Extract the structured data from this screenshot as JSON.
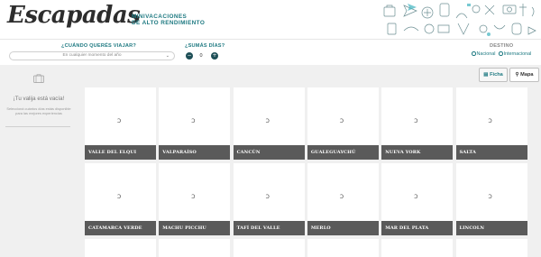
{
  "header": {
    "logo": "Escapadas",
    "tagline_line1": "MINIVACACIONES",
    "tagline_line2": "DE ALTO RENDIMIENTO"
  },
  "filters": {
    "when_label": "¿CUÁNDO QUERÉS VIAJAR?",
    "when_value": "En cualquier momento del año",
    "days_label": "¿SUMÁS DÍAS?",
    "days_value": "0",
    "minus_label": "−",
    "plus_label": "+",
    "destination_label": "DESTINO",
    "destination_options": [
      "Nacional",
      "Internacional"
    ]
  },
  "sidebar": {
    "empty_title": "¡Tu valija está vacía!",
    "empty_description": "Seleccioná cuántos días estás disponible para las mejores experiencias"
  },
  "view_toggle": {
    "ficha": "Ficha",
    "mapa": "Mapa"
  },
  "destinations": [
    "VALLE DEL ELQUI",
    "VALPARAÍSO",
    "CANCÚN",
    "GUALEGUAYCHÚ",
    "NUEVA YORK",
    "SALTA",
    "CATAMARCA VERDE",
    "MACHU PICCHU",
    "TAFÍ DEL VALLE",
    "MERLO",
    "MAR DEL PLATA",
    "LINCOLN"
  ],
  "colors": {
    "accent": "#1f7a82",
    "dark_teal": "#1e4f57",
    "card_label_bg": "#5a5a5a",
    "main_bg": "#f0f0f0"
  },
  "icons": {
    "suitcase": "suitcase-icon",
    "map": "map-icon",
    "list": "list-icon",
    "chevron": "chevron-down-icon",
    "loading": "loading-spinner-icon"
  }
}
